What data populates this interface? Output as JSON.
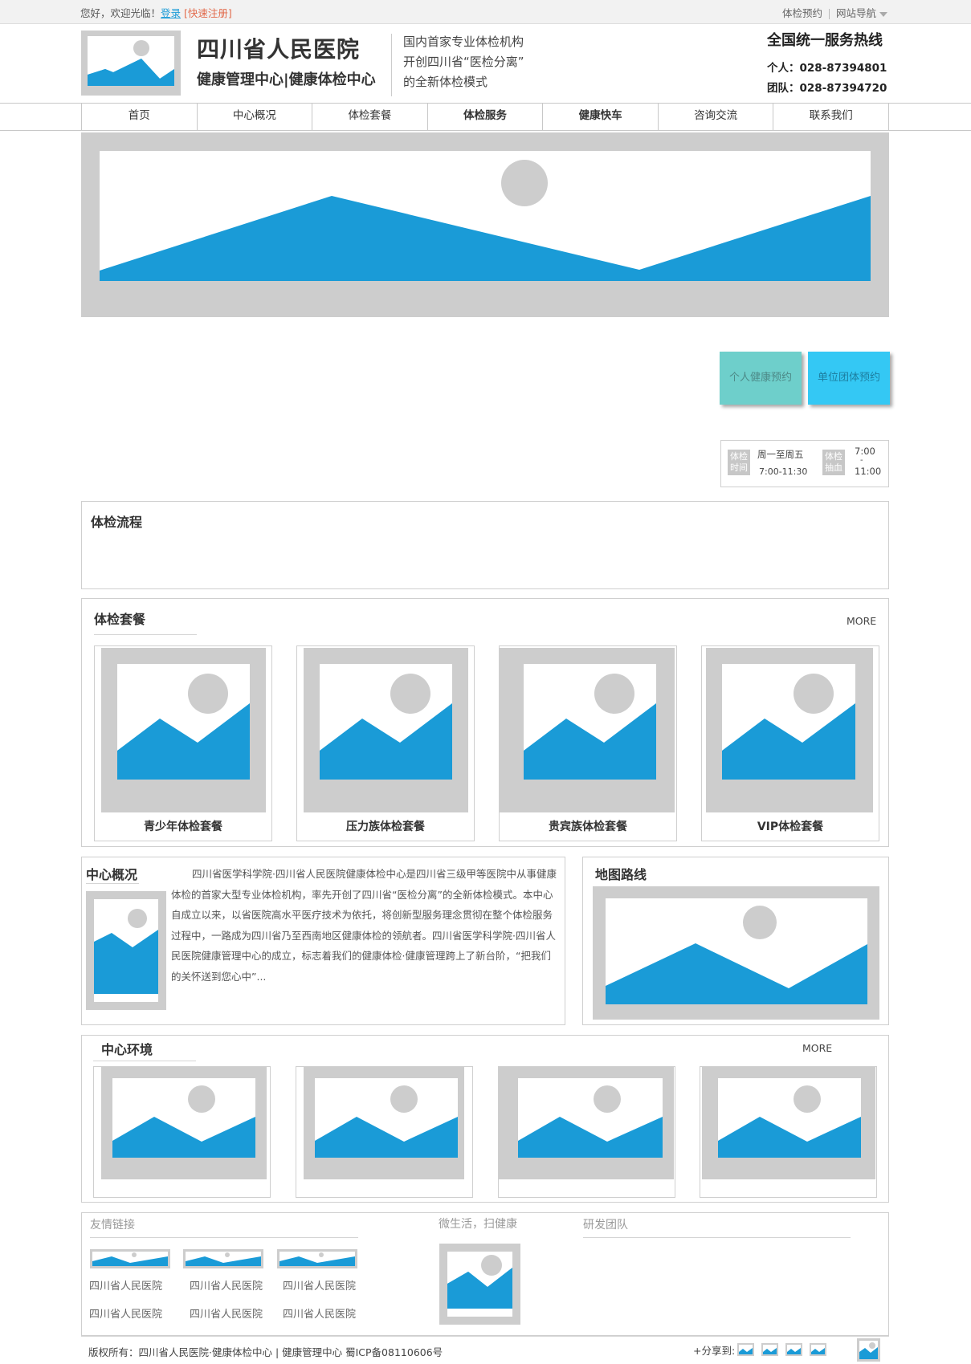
{
  "topbar": {
    "greeting": "您好，欢迎光临！",
    "login": "登录",
    "register": "[快速注册]",
    "appointment": "体检预约",
    "sitenav": "网站导航"
  },
  "header": {
    "title": "四川省人民医院",
    "subtitle": "健康管理中心|健康体检中心",
    "slogan": [
      "国内首家专业体检机构",
      "开创四川省“医检分离”",
      "的全新体检模式"
    ],
    "hotline": "全国统一服务热线",
    "phone_personal": "个人：028-87394801",
    "phone_team": "团队：028-87394720"
  },
  "nav": [
    "首页",
    "中心概况",
    "体检套餐",
    "体检服务",
    "健康快车",
    "咨询交流",
    "联系我们"
  ],
  "buttons": {
    "personal": "个人健康预约",
    "group": "单位团体预约"
  },
  "hours": {
    "tag1": "体检时间",
    "time1_a": "周一至周五",
    "time1_b": "7:00-11:30",
    "tag2": "体检抽血",
    "time2_a": "7:00",
    "time2_dash": "-",
    "time2_b": "11:00"
  },
  "process": {
    "title": "体检流程"
  },
  "packages": {
    "title": "体检套餐",
    "more": "MORE",
    "items": [
      "青少年体检套餐",
      "压力族体检套餐",
      "贵宾族体检套餐",
      "VIP体检套餐"
    ]
  },
  "overview": {
    "title": "中心概况",
    "text": "四川省医学科学院·四川省人民医院健康体检中心是四川省三级甲等医院中从事健康体检的首家大型专业体检机构，率先开创了四川省“医检分离”的全新体检模式。本中心自成立以来，以省医院高水平医疗技术为依托，将创新型服务理念贯彻在整个体检服务过程中，一路成为四川省乃至西南地区健康体检的领航者。四川省医学科学院·四川省人民医院健康管理中心的成立，标志着我们的健康体检·健康管理跨上了新台阶，“把我们的关怀送到您心中”..."
  },
  "map": {
    "title": "地图路线"
  },
  "environment": {
    "title": "中心环境",
    "more": "MORE"
  },
  "links": {
    "title": "友情链接",
    "items": [
      "四川省人民医院",
      "四川省人民医院",
      "四川省人民医院",
      "四川省人民医院",
      "四川省人民医院",
      "四川省人民医院"
    ]
  },
  "wechat": {
    "title": "微生活，扫健康"
  },
  "team": {
    "title": "研发团队"
  },
  "footer": {
    "copyright": "版权所有：四川省人民医院·健康体检中心 | 健康管理中心  蜀ICP备08110606号",
    "share": "+分享到:"
  },
  "colors": {
    "accent": "#1a9bd7",
    "placeholder": "#cdcdcd",
    "btn_personal": "#6ecfcb",
    "btn_group": "#34c8f4"
  }
}
